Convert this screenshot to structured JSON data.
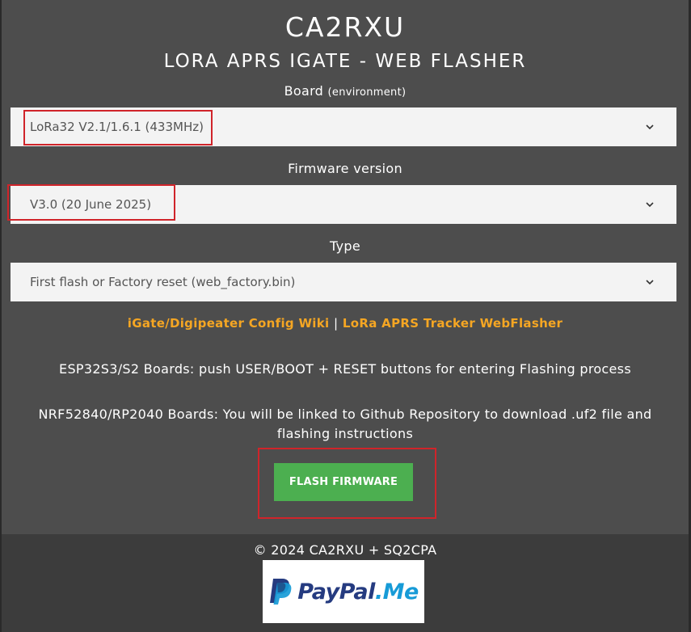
{
  "header": {
    "title": "CA2RXU",
    "subtitle": "LORA APRS IGATE - WEB FLASHER"
  },
  "board": {
    "label": "Board",
    "label_small": "(environment)",
    "value": "LoRa32 V2.1/1.6.1 (433MHz)"
  },
  "firmware": {
    "label": "Firmware version",
    "value": "V3.0 (20 June 2025)"
  },
  "type": {
    "label": "Type",
    "value": "First flash or Factory reset (web_factory.bin)"
  },
  "links": {
    "wiki": "iGate/Digipeater Config Wiki",
    "separator": "|",
    "tracker": "LoRa APRS Tracker WebFlasher"
  },
  "notes": {
    "esp": "ESP32S3/S2 Boards: push USER/BOOT + RESET buttons for entering Flashing process",
    "nrf": "NRF52840/RP2040 Boards: You will be linked to Github Repository to download .uf2 file and flashing instructions"
  },
  "actions": {
    "flash_label": "FLASH FIRMWARE"
  },
  "footer": {
    "copyright": "© 2024 CA2RXU + SQ2CPA",
    "paypal_pay": "PayPal",
    "paypal_me": ".Me"
  },
  "colors": {
    "background": "#4d4d4d",
    "accent_link": "#f5a623",
    "button": "#4caf50",
    "highlight_box": "#d0242a"
  }
}
